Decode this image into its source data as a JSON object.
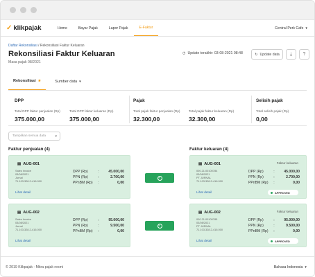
{
  "window": {
    "dots": [
      "red",
      "yellow",
      "green"
    ]
  },
  "nav": {
    "brand": "klikpajak",
    "brand_sub": "by mekari",
    "items": [
      {
        "label": "Home"
      },
      {
        "label": "Bayar Pajak"
      },
      {
        "label": "Lapor Pajak"
      },
      {
        "label": "E-Faktur",
        "active": true
      }
    ],
    "company": "Central Perk Cafe"
  },
  "breadcrumb": {
    "parent": "Daftar Rekonsiliasi",
    "sep": " / ",
    "current": "Rekonsiliasi Faktur Keluaran"
  },
  "page": {
    "title": "Rekonsiliasi Faktur Keluaran",
    "period": "Masa pajak 08/2021",
    "updated": "Update terakhir: 03-08-2021 08:48",
    "update_button": "Update data"
  },
  "tabs": [
    {
      "label": "Rekonsiliasi",
      "active": true,
      "icon": "star-icon"
    },
    {
      "label": "Sumber data",
      "dropdown": true
    }
  ],
  "summary": {
    "dpp": {
      "heading": "DPP",
      "left_label": "Total DPP faktur penjualan (Rp)",
      "left_value": "375.000,00",
      "right_label": "Total DPP faktur keluaran (Rp)",
      "right_value": "375.000,00"
    },
    "pajak": {
      "heading": "Pajak",
      "left_label": "Total pajak faktur penjualan (Rp)",
      "left_value": "32.300,00",
      "right_label": "Total pajak faktur keluaran (Rp)",
      "right_value": "32.300,00"
    },
    "selisih": {
      "heading": "Selisih pajak",
      "label": "Total selisih pajak (Rp)",
      "value": "0,00"
    }
  },
  "filter": {
    "placeholder": "Tampilkan semua data"
  },
  "sections": {
    "penjualan": "Faktur penjualan (4)",
    "keluaran": "Faktur keluaran (4)"
  },
  "labels": {
    "dpp": "DPP (Rp)",
    "ppn": "PPN (Rp)",
    "ppnbm": "PPnBM (Rp)",
    "colon": ":",
    "link": "Lihat detail",
    "type": "Faktur keluaran",
    "approved": "APPROVED"
  },
  "sales_cards": [
    {
      "id": "AUG-001",
      "meta1": "Sales Invoice",
      "meta2": "03/08/2021",
      "meta3": "Jurnal",
      "meta4": "71.103.328.2-416.000",
      "dpp": "45.000,00",
      "ppn": "2.700,00",
      "ppnbm": "0,00"
    },
    {
      "id": "AUG-002",
      "meta1": "Sales Invoice",
      "meta2": "03/08/2021",
      "meta3": "Jurnal",
      "meta4": "71.103.328.2-416.000",
      "dpp": "95.000,00",
      "ppn": "9.500,00",
      "ppnbm": "0,00"
    }
  ],
  "output_cards": [
    {
      "id": "AUG-001",
      "meta1": "000.21.00100784",
      "meta2": "03/08/2021",
      "meta3": "PT JURNAL",
      "meta4": "71.103.328.2-416.000",
      "dpp": "45.000,00",
      "ppn": "2.700,00",
      "ppnbm": "0,00"
    },
    {
      "id": "AUG-002",
      "meta1": "000.21.00100785",
      "meta2": "03/08/2021",
      "meta3": "PT JURNAL",
      "meta4": "71.103.328.2-416.000",
      "dpp": "95.000,00",
      "ppn": "9.500,00",
      "ppnbm": "0,00"
    }
  ],
  "footer": {
    "copyright": "© 2019 Klikpajak - Mitra pajak resmi",
    "language": "Bahasa Indonesia"
  },
  "colors": {
    "accent": "#f39c12",
    "match": "#27a35b",
    "card_bg": "#d9efe0",
    "link": "#2e6bb6"
  }
}
